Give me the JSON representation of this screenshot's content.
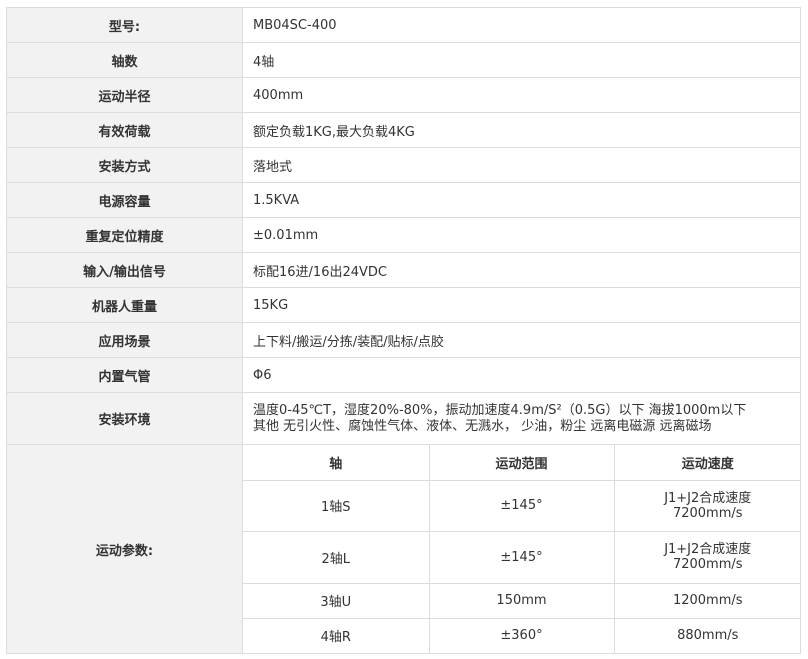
{
  "rows": [
    {
      "label": "型号:",
      "value": "MB04SC-400"
    },
    {
      "label": "轴数",
      "value": "4轴"
    },
    {
      "label": "运动半径",
      "value": "400mm"
    },
    {
      "label": "有效荷载",
      "value": "额定负载1KG,最大负载4KG"
    },
    {
      "label": "安装方式",
      "value": "落地式"
    },
    {
      "label": "电源容量",
      "value": "1.5KVA"
    },
    {
      "label": "重复定位精度",
      "value": "±0.01mm"
    },
    {
      "label": "输入/输出信号",
      "value": "标配16进/16出24VDC"
    },
    {
      "label": "机器人重量",
      "value": "15KG"
    },
    {
      "label": "应用场景",
      "value": "上下料/搬运/分拣/装配/贴标/点胶"
    },
    {
      "label": "内置气管",
      "value": "Φ6"
    },
    {
      "label": "安装环境",
      "value_line1": "温度0-45℃T，湿度20%-80%，振动加速度4.9m/S²（0.5G）以下 海拔1000m以下",
      "value_line2": "其他 无引火性、腐蚀性气体、液体、无溅水， 少油，粉尘 远离电磁源 远离磁场"
    }
  ],
  "motion": {
    "label": "运动参数:",
    "headers": [
      "轴",
      "运动范围",
      "运动速度"
    ],
    "axes": [
      {
        "axis": "1轴S",
        "range": "±145°",
        "speed_line1": "J1+J2合成速度",
        "speed_line2": "7200mm/s"
      },
      {
        "axis": "2轴L",
        "range": "±145°",
        "speed_line1": "J1+J2合成速度",
        "speed_line2": "7200mm/s"
      },
      {
        "axis": "3轴U",
        "range": "150mm",
        "speed": "1200mm/s"
      },
      {
        "axis": "4轴R",
        "range": "±360°",
        "speed": "880mm/s"
      }
    ]
  }
}
